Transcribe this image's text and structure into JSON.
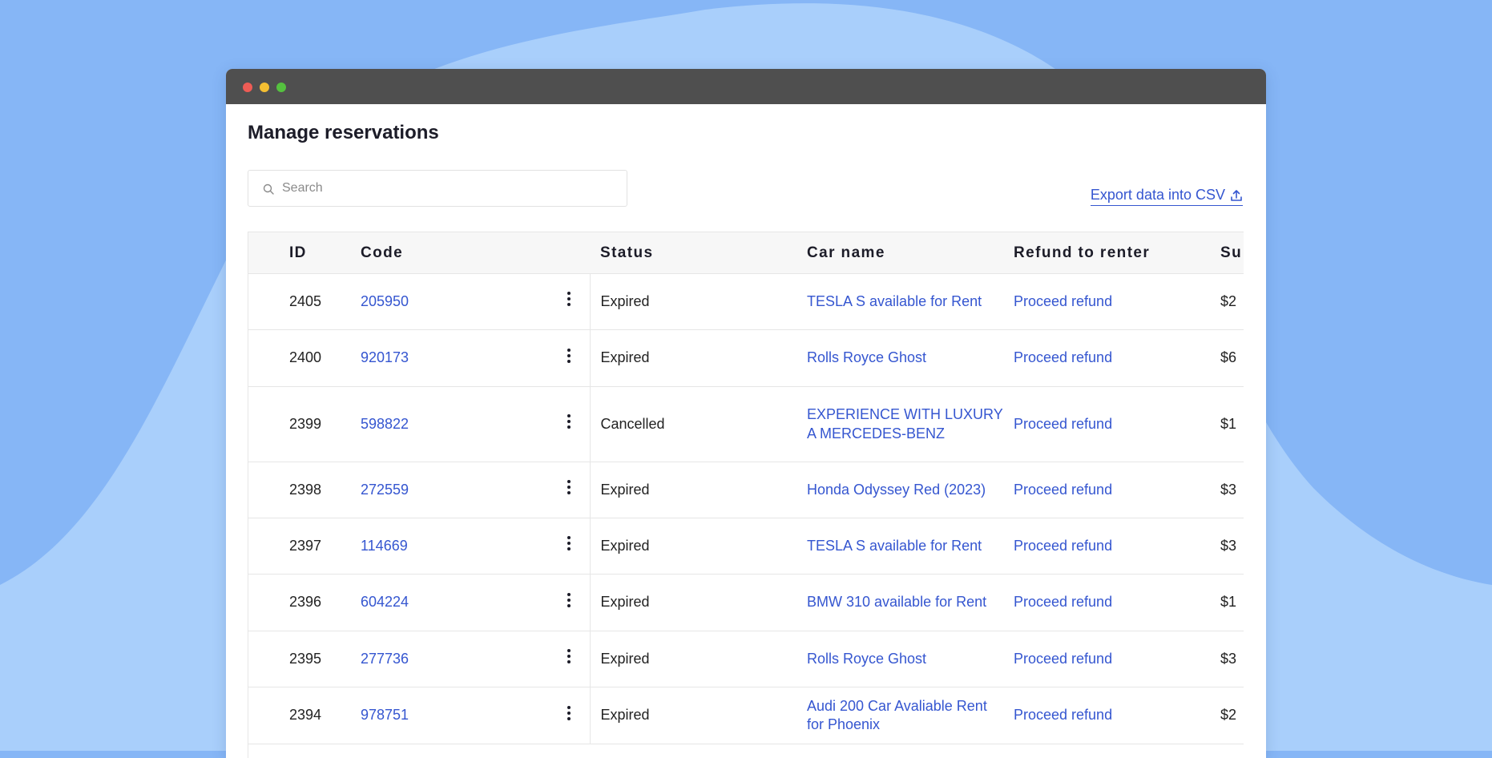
{
  "window": {
    "title": ""
  },
  "page": {
    "title": "Manage reservations"
  },
  "search": {
    "placeholder": "Search",
    "value": ""
  },
  "export": {
    "label": "Export data into CSV"
  },
  "table": {
    "headers": {
      "id": "ID",
      "code": "Code",
      "status": "Status",
      "car_name": "Car name",
      "refund": "Refund to renter",
      "subtotal": "Su"
    },
    "rows": [
      {
        "id": "2405",
        "code": "205950",
        "status": "Expired",
        "car_name": "TESLA S available for Rent",
        "refund": "Proceed refund",
        "subtotal": "$2"
      },
      {
        "id": "2400",
        "code": "920173",
        "status": "Expired",
        "car_name": "Rolls Royce Ghost",
        "refund": "Proceed refund",
        "subtotal": "$6"
      },
      {
        "id": "2399",
        "code": "598822",
        "status": "Cancelled",
        "car_name": "EXPERIENCE WITH LUXURY A MERCEDES-BENZ",
        "refund": "Proceed refund",
        "subtotal": "$1"
      },
      {
        "id": "2398",
        "code": "272559",
        "status": "Expired",
        "car_name": "Honda Odyssey Red (2023)",
        "refund": "Proceed refund",
        "subtotal": "$3"
      },
      {
        "id": "2397",
        "code": "114669",
        "status": "Expired",
        "car_name": "TESLA S available for Rent",
        "refund": "Proceed refund",
        "subtotal": "$3"
      },
      {
        "id": "2396",
        "code": "604224",
        "status": "Expired",
        "car_name": "BMW 310 available for Rent",
        "refund": "Proceed refund",
        "subtotal": "$1"
      },
      {
        "id": "2395",
        "code": "277736",
        "status": "Expired",
        "car_name": "Rolls Royce Ghost",
        "refund": "Proceed refund",
        "subtotal": "$3"
      },
      {
        "id": "2394",
        "code": "978751",
        "status": "Expired",
        "car_name": "Audi 200 Car Avaliable Rent for Phoenix",
        "refund": "Proceed refund",
        "subtotal": "$2"
      }
    ]
  },
  "colors": {
    "background": "#86b6f6",
    "wave": "#a9cffb",
    "titlebar": "#4f4f4f",
    "link": "#3556d0",
    "header_bg": "#f7f7f7"
  }
}
